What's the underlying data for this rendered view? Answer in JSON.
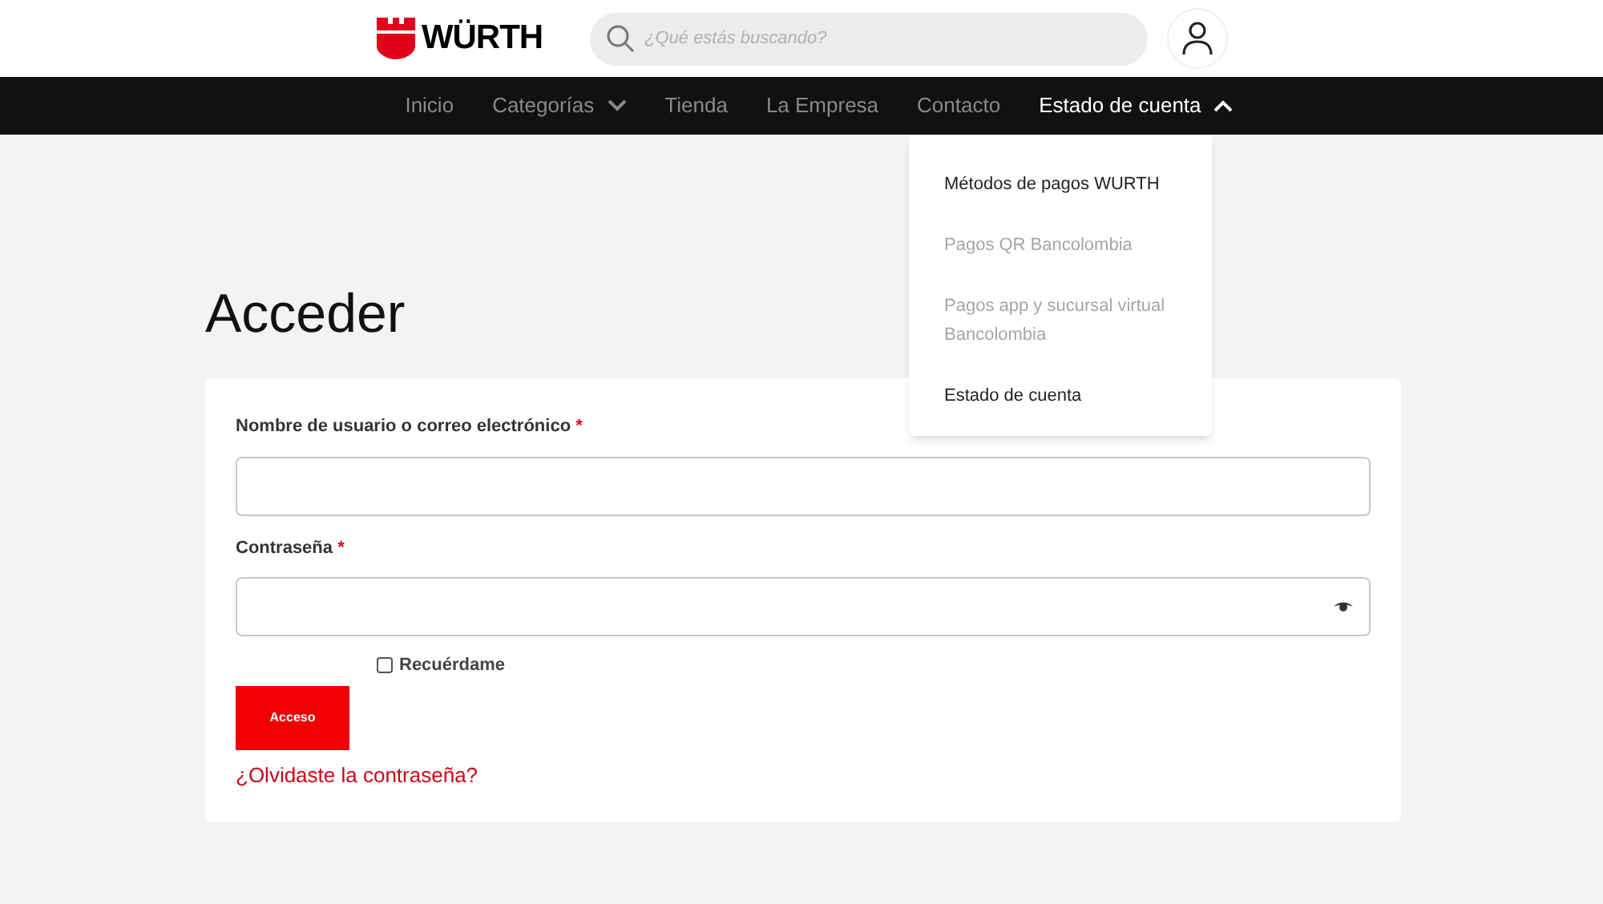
{
  "header": {
    "logo_text": "WÜRTH",
    "search": {
      "placeholder": "¿Qué estás buscando?"
    }
  },
  "nav": [
    {
      "label": "Inicio",
      "selected": false
    },
    {
      "label": "Categorías",
      "selected": false,
      "expanded": false
    },
    {
      "label": "Tienda",
      "selected": false
    },
    {
      "label": "La Empresa",
      "selected": false
    },
    {
      "label": "Contacto",
      "selected": false
    },
    {
      "label": "Estado de cuenta",
      "selected": true,
      "expanded": true
    }
  ],
  "dropdown": [
    {
      "label": "Métodos de pagos WURTH",
      "dimmed": false
    },
    {
      "label": "Pagos QR Bancolombia",
      "dimmed": true
    },
    {
      "label": "Pagos app y sucursal virtual Bancolombia",
      "dimmed": true
    },
    {
      "label": "Estado de cuenta",
      "dimmed": false
    }
  ],
  "title": "Acceder",
  "form": {
    "username_label": "Nombre de usuario o correo electrónico",
    "password_label": "Contraseña",
    "required_mark": "*",
    "remember": {
      "label": "Recuérdame",
      "checked": false
    },
    "submit": "Acceso",
    "forgot_link": "¿Olvidaste la contraseña?"
  }
}
